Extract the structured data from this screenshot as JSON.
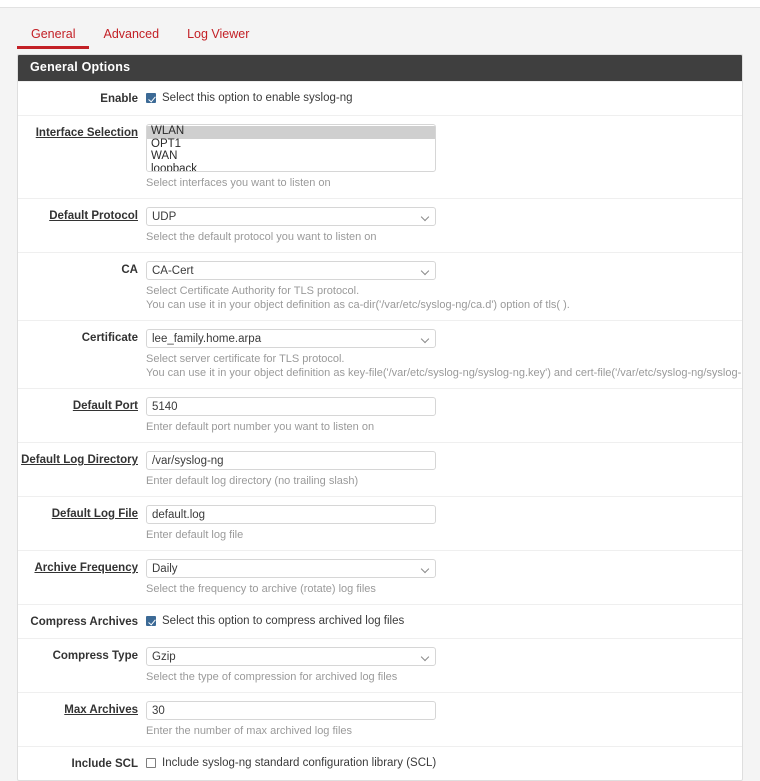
{
  "tabs": [
    {
      "label": "General",
      "active": true
    },
    {
      "label": "Advanced",
      "active": false
    },
    {
      "label": "Log Viewer",
      "active": false
    }
  ],
  "panel": {
    "header": "General Options"
  },
  "accent_color": "#c32026",
  "header_bg": "#3f3f3f",
  "checkbox_on_color": "#3c6a96",
  "listbox_selected_bg": "#cfcfcf",
  "fields": {
    "enable": {
      "label": "Enable",
      "underline": false,
      "checkbox_text": "Select this option to enable syslog-ng",
      "checked": true
    },
    "interface_selection": {
      "label": "Interface Selection",
      "underline": true,
      "options": [
        "WLAN",
        "OPT1",
        "WAN",
        "loopback"
      ],
      "selected": "WLAN",
      "help": "Select interfaces you want to listen on"
    },
    "default_protocol": {
      "label": "Default Protocol",
      "underline": true,
      "value": "UDP",
      "help": "Select the default protocol you want to listen on"
    },
    "ca": {
      "label": "CA",
      "underline": false,
      "value": "CA-Cert",
      "help1": "Select Certificate Authority for TLS protocol.",
      "help2": "You can use it in your object definition as ca-dir('/var/etc/syslog-ng/ca.d') option of tls( )."
    },
    "certificate": {
      "label": "Certificate",
      "underline": false,
      "value": "lee_family.home.arpa",
      "help1": "Select server certificate for TLS protocol.",
      "help2": "You can use it in your object definition as key-file('/var/etc/syslog-ng/syslog-ng.key') and cert-file('/var/etc/syslog-ng/syslog-ng.cert') options of tls( )."
    },
    "default_port": {
      "label": "Default Port",
      "underline": true,
      "value": "5140",
      "help": "Enter default port number you want to listen on"
    },
    "default_log_directory": {
      "label": "Default Log Directory",
      "underline": true,
      "value": "/var/syslog-ng",
      "help": "Enter default log directory (no trailing slash)"
    },
    "default_log_file": {
      "label": "Default Log File",
      "underline": true,
      "value": "default.log",
      "help": "Enter default log file"
    },
    "archive_frequency": {
      "label": "Archive Frequency",
      "underline": true,
      "value": "Daily",
      "help": "Select the frequency to archive (rotate) log files"
    },
    "compress_archives": {
      "label": "Compress Archives",
      "underline": false,
      "checkbox_text": "Select this option to compress archived log files",
      "checked": true
    },
    "compress_type": {
      "label": "Compress Type",
      "underline": false,
      "value": "Gzip",
      "help": "Select the type of compression for archived log files"
    },
    "max_archives": {
      "label": "Max Archives",
      "underline": true,
      "value": "30",
      "help": "Enter the number of max archived log files"
    },
    "include_scl": {
      "label": "Include SCL",
      "underline": false,
      "checkbox_text": "Include syslog-ng standard configuration library (SCL)",
      "checked": false
    }
  }
}
